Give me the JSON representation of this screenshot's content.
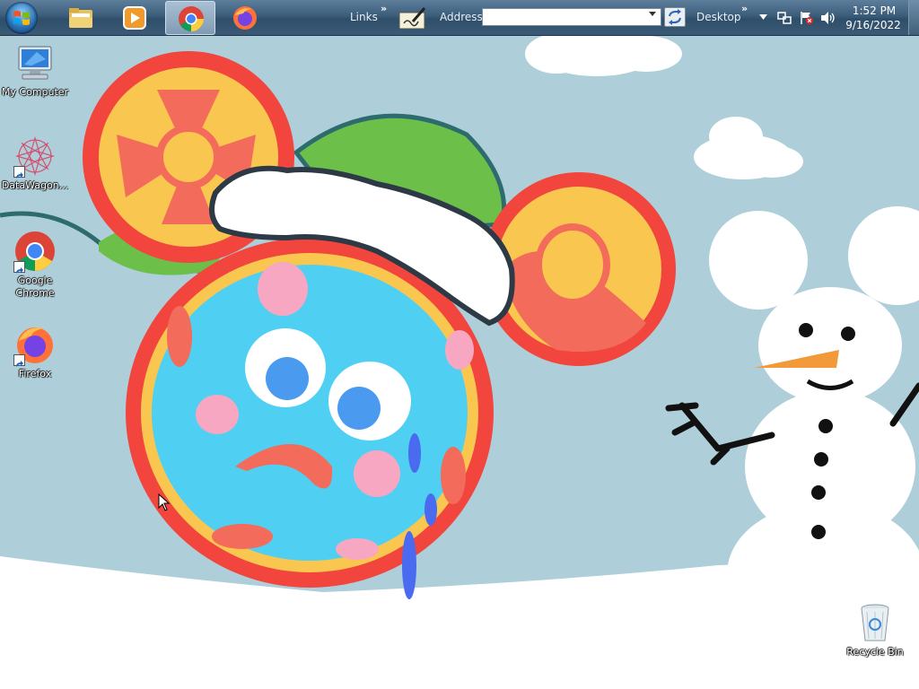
{
  "taskbar": {
    "start": {
      "icon": "windows-start-orb"
    },
    "pinned": [
      {
        "name": "explorer",
        "icon": "folder-icon",
        "active": false
      },
      {
        "name": "media-player",
        "icon": "media-player-icon",
        "active": false
      },
      {
        "name": "chrome",
        "icon": "chrome-icon",
        "active": true
      },
      {
        "name": "firefox",
        "icon": "firefox-icon",
        "active": false
      }
    ],
    "links_label": "Links",
    "address_label": "Address",
    "address_value": "",
    "desktop_label": "Desktop",
    "clock": {
      "time": "1:52 PM",
      "date": "9/16/2022"
    }
  },
  "desktop": {
    "icons": [
      {
        "label": "My Computer",
        "icon": "computer-icon"
      },
      {
        "label": "DataWagon...",
        "icon": "datawagon-icon"
      },
      {
        "label": "Google Chrome",
        "icon": "chrome-icon"
      },
      {
        "label": "Firefox",
        "icon": "firefox-icon"
      },
      {
        "label": "Recycle Bin",
        "icon": "recycle-bin-icon"
      }
    ]
  },
  "colors": {
    "sky": "#aecfd9",
    "snow": "#ffffff",
    "red": "#f1453d",
    "yellow": "#f9c74f",
    "blue": "#4fd0f3",
    "green": "#6cc04a"
  }
}
